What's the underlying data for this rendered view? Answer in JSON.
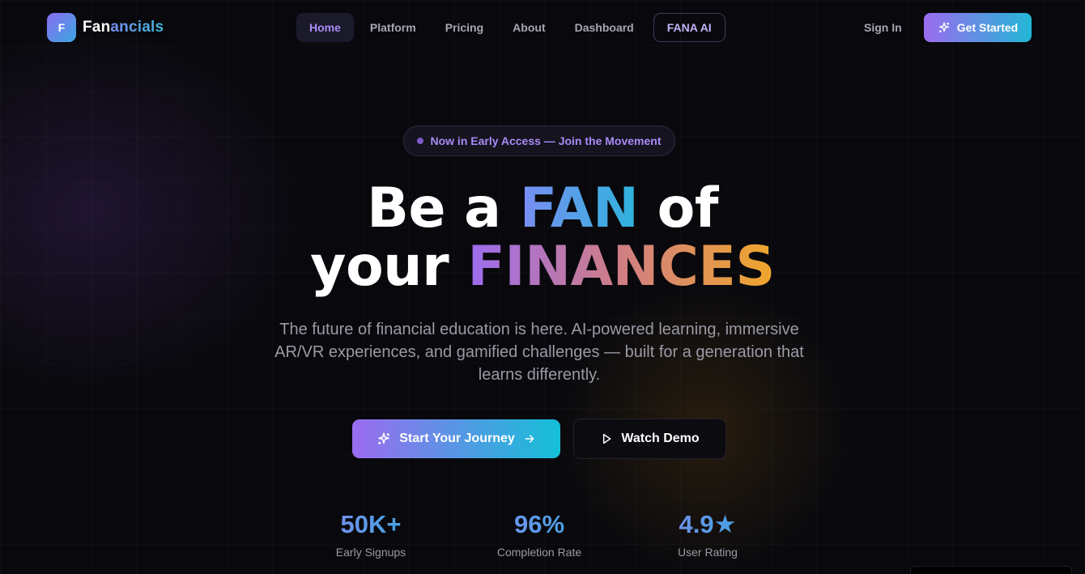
{
  "nav": {
    "logo_mark": "F",
    "logo_text_a": "Fan",
    "logo_text_b": "ancials",
    "links": [
      {
        "label": "Home",
        "active": true
      },
      {
        "label": "Platform"
      },
      {
        "label": "Pricing"
      },
      {
        "label": "About"
      },
      {
        "label": "Dashboard"
      },
      {
        "label": "FANA AI",
        "outlined": true
      }
    ],
    "sign_in": "Sign In",
    "get_started": "Get Started"
  },
  "hero": {
    "badge": "Now in Early Access — Join the Movement",
    "headline_1a": "Be a ",
    "headline_1b": "FAN",
    "headline_1c": " of",
    "headline_2a": "your ",
    "headline_2b": "FINANCES",
    "subtitle": "The future of financial education is here. AI-powered learning, immersive AR/VR experiences, and gamified challenges — built for a generation that learns differently.",
    "primary_cta": "Start Your Journey",
    "secondary_cta": "Watch Demo"
  },
  "stats": [
    {
      "value": "50K+",
      "label": "Early Signups"
    },
    {
      "value": "96%",
      "label": "Completion Rate"
    },
    {
      "value": "4.9★",
      "label": "User Rating"
    }
  ],
  "colors": {
    "background": "#09090d",
    "accent_purple": "#9b6cf0",
    "accent_cyan": "#22b7d6",
    "accent_orange": "#f0a72a"
  },
  "icons": {
    "get_started": "sparkles-icon",
    "primary_cta_leading": "sparkles-icon",
    "primary_cta_trailing": "arrow-right-icon",
    "secondary_cta": "play-icon"
  }
}
